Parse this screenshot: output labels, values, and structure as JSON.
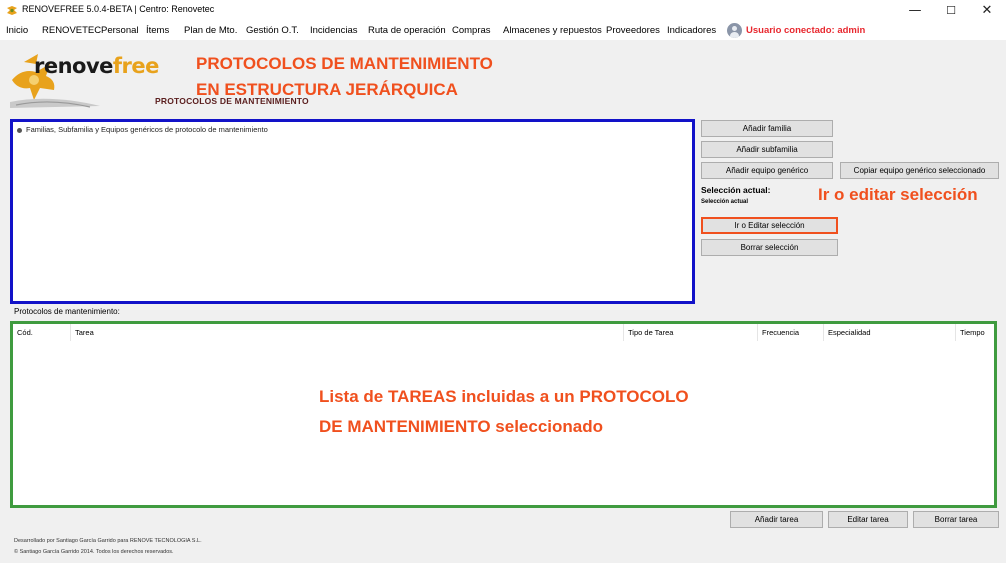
{
  "window": {
    "title": "RENOVEFREE 5.0.4-BETA | Centro: Renovetec",
    "minimize_glyph": "—",
    "maximize_glyph": "☐",
    "close_glyph": "✕"
  },
  "menu": {
    "items": [
      "Inicio",
      "RENOVETEC",
      "Personal",
      "Ítems",
      "Plan de Mto.",
      "Gestión O.T.",
      "Incidencias",
      "Ruta de operación",
      "Compras",
      "Almacenes y repuestos",
      "Proveedores",
      "Indicadores"
    ],
    "user_label": "Usuario conectado: admin"
  },
  "header": {
    "logo_text_main": "renove",
    "logo_text_accent": "free",
    "page_title": "PROTOCOLOS DE MANTENIMIENTO"
  },
  "tree": {
    "root_label": "Familias, Subfamilia y Equipos genéricos de protocolo de mantenimiento",
    "overlay_line1": "PROTOCOLOS DE MANTENIMIENTO",
    "overlay_line2": "EN ESTRUCTURA JERÁRQUICA"
  },
  "actions": {
    "add_family": "Añadir familia",
    "add_subfamily": "Añadir subfamilia",
    "add_generic_equipment": "Añadir equipo genérico",
    "copy_generic_equipment": "Copiar equipo genérico seleccionado",
    "selection_label": "Selección actual:",
    "selection_value": "Selección actual",
    "goto_selection": "Ir o Editar selección",
    "delete_selection": "Borrar selección",
    "goto_overlay": "Ir o editar selección"
  },
  "task_list": {
    "caption": "Protocolos de mantenimiento:",
    "columns": [
      "Cód.",
      "Tarea",
      "Tipo de Tarea",
      "Frecuencia",
      "Especialidad",
      "Tiempo"
    ],
    "overlay_line1": "Lista de TAREAS incluidas a un PROTOCOLO",
    "overlay_line2": "DE MANTENIMIENTO seleccionado"
  },
  "task_actions": {
    "add_task": "Añadir tarea",
    "edit_task": "Editar tarea",
    "delete_task": "Borrar tarea"
  },
  "footer": {
    "line1": "Desarrollado por Santiago García Garrido para RENOVE TECNOLOGIA S.L.",
    "line2": "© Santiago García Garrido 2014. Todos los derechos reservados."
  },
  "colors": {
    "tree_border": "#1212c8",
    "list_border": "#3f9b3f",
    "annotation": "#f0501e",
    "user_text": "#e8282f"
  }
}
